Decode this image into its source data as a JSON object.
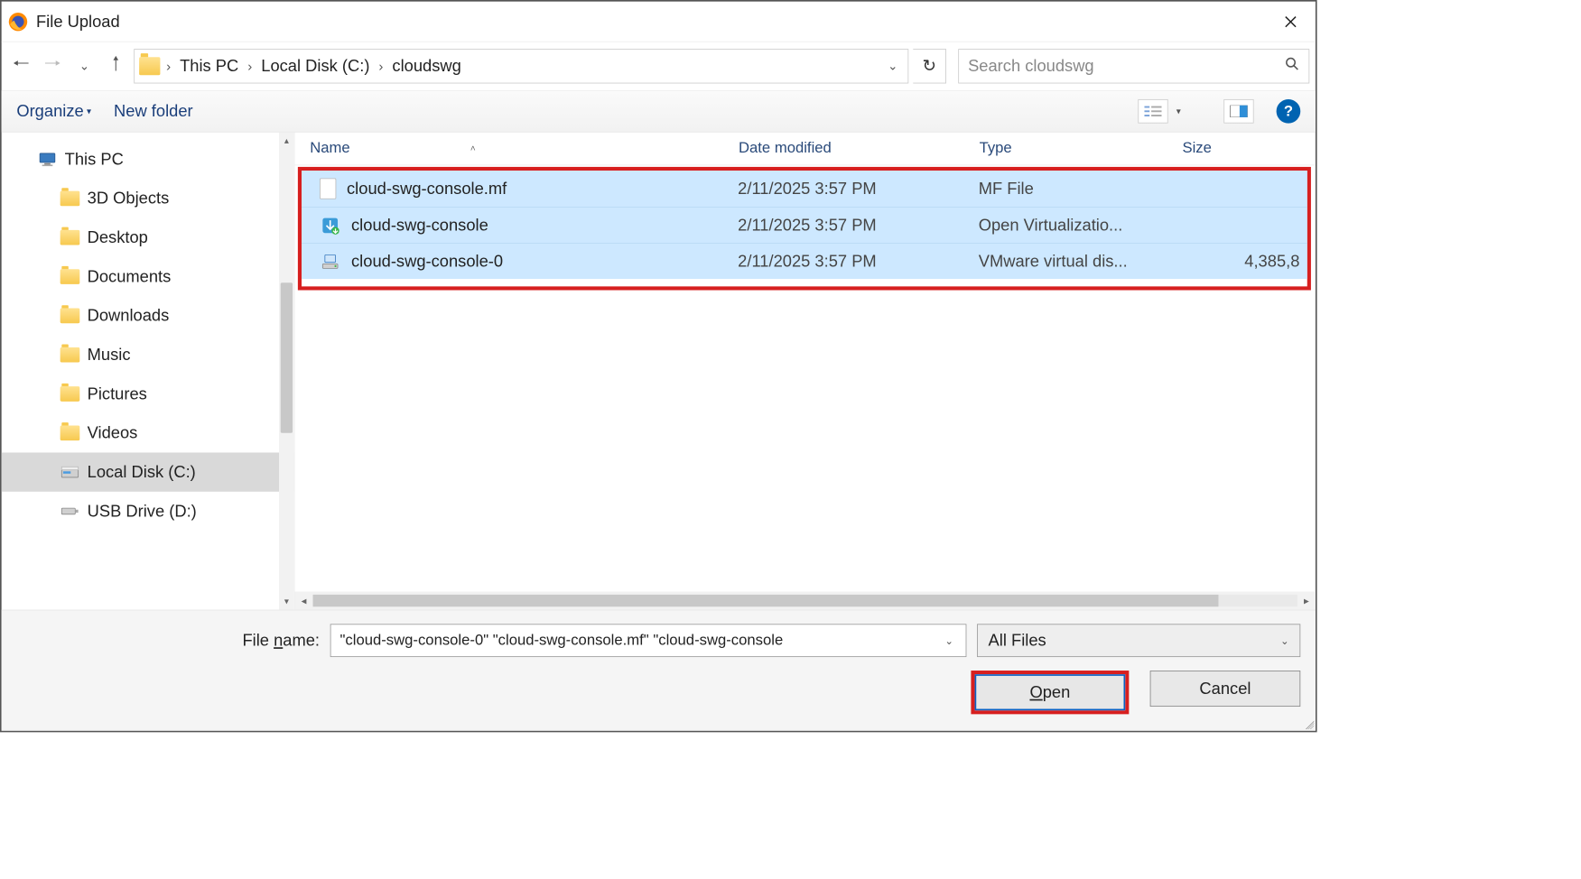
{
  "window": {
    "title": "File Upload"
  },
  "breadcrumb": {
    "segments": [
      "This PC",
      "Local Disk (C:)",
      "cloudswg"
    ]
  },
  "search": {
    "placeholder": "Search cloudswg"
  },
  "toolbar": {
    "organize": "Organize",
    "newfolder": "New folder"
  },
  "tree": {
    "root": "This PC",
    "items": [
      {
        "label": "3D Objects",
        "icon": "folder"
      },
      {
        "label": "Desktop",
        "icon": "folder"
      },
      {
        "label": "Documents",
        "icon": "folder"
      },
      {
        "label": "Downloads",
        "icon": "folder"
      },
      {
        "label": "Music",
        "icon": "folder"
      },
      {
        "label": "Pictures",
        "icon": "folder"
      },
      {
        "label": "Videos",
        "icon": "folder"
      },
      {
        "label": "Local Disk (C:)",
        "icon": "disk",
        "selected": true
      },
      {
        "label": "USB Drive (D:)",
        "icon": "usb"
      }
    ]
  },
  "columns": {
    "name": "Name",
    "date": "Date modified",
    "type": "Type",
    "size": "Size"
  },
  "files": [
    {
      "name": "cloud-swg-console.mf",
      "date": "2/11/2025 3:57 PM",
      "type": "MF File",
      "size": "",
      "icon": "generic"
    },
    {
      "name": "cloud-swg-console",
      "date": "2/11/2025 3:57 PM",
      "type": "Open Virtualizatio...",
      "size": "",
      "icon": "ovf"
    },
    {
      "name": "cloud-swg-console-0",
      "date": "2/11/2025 3:57 PM",
      "type": "VMware virtual dis...",
      "size": "4,385,8",
      "icon": "vmdk"
    }
  ],
  "footer": {
    "fileNameLabel": "File name:",
    "fileNameValue": "\"cloud-swg-console-0\" \"cloud-swg-console.mf\" \"cloud-swg-console",
    "filter": "All Files",
    "open": "Open",
    "cancel": "Cancel"
  }
}
